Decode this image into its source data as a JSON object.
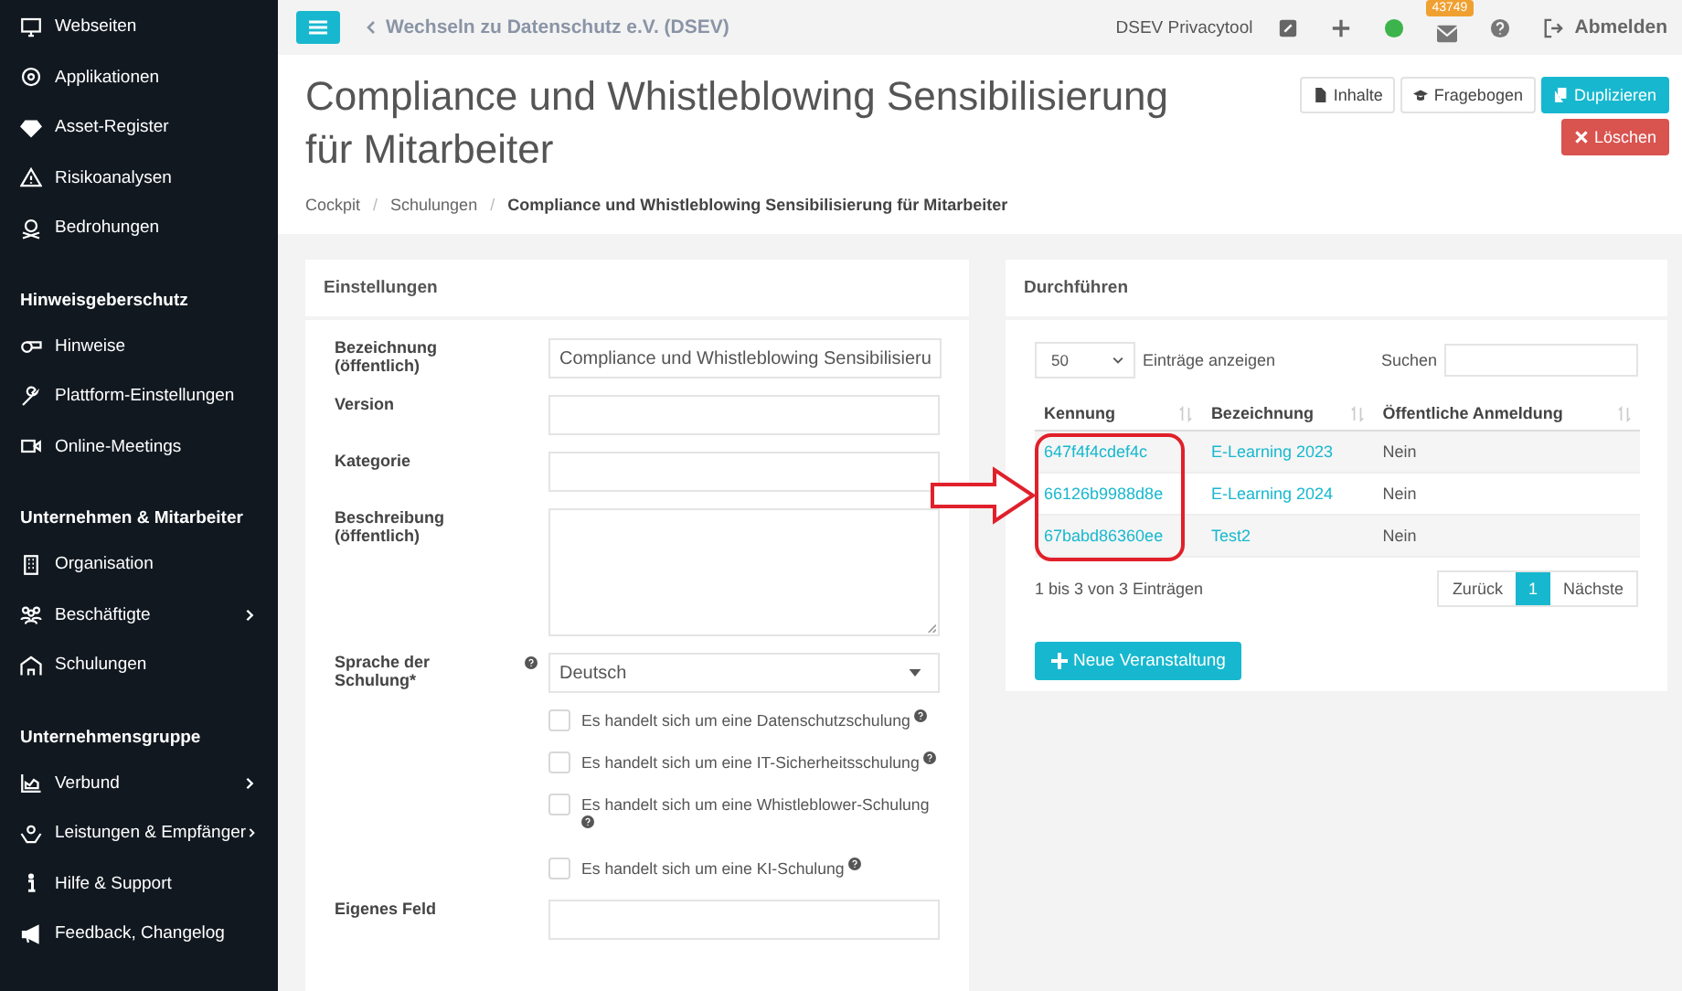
{
  "sidebar": {
    "groups": [
      {
        "items": [
          {
            "label": "Webseiten",
            "submenu": false
          },
          {
            "label": "Applikationen",
            "submenu": false
          },
          {
            "label": "Asset-Register",
            "submenu": false
          },
          {
            "label": "Risikoanalysen",
            "submenu": false
          },
          {
            "label": "Bedrohungen",
            "submenu": false
          }
        ]
      },
      {
        "heading": "Hinweisgeberschutz",
        "items": [
          {
            "label": "Hinweise",
            "submenu": false
          },
          {
            "label": "Plattform-Einstellungen",
            "submenu": false
          },
          {
            "label": "Online-Meetings",
            "submenu": false
          }
        ]
      },
      {
        "heading": "Unternehmen & Mitarbeiter",
        "items": [
          {
            "label": "Organisation",
            "submenu": false
          },
          {
            "label": "Beschäftigte",
            "submenu": true
          },
          {
            "label": "Schulungen",
            "submenu": false
          }
        ]
      },
      {
        "heading": "Unternehmensgruppe",
        "items": [
          {
            "label": "Verbund",
            "submenu": true
          },
          {
            "label": "Leistungen & Empfänger",
            "submenu": true
          },
          {
            "label": "Hilfe & Support",
            "submenu": false
          },
          {
            "label": "Feedback, Changelog",
            "submenu": false
          }
        ]
      }
    ]
  },
  "topbar": {
    "back_link": "Wechseln zu Datenschutz e.V. (DSEV)",
    "app_name": "DSEV Privacytool",
    "mail_badge": "43749",
    "logout": "Abmelden"
  },
  "header": {
    "title": "Compliance und Whistleblowing Sensibilisierung für Mitarbeiter",
    "buttons": [
      {
        "kind": "plain",
        "label": "Inhalte"
      },
      {
        "kind": "plain",
        "label": "Fragebogen"
      },
      {
        "kind": "primary",
        "label": "Duplizieren"
      },
      {
        "kind": "danger",
        "label": "Löschen"
      }
    ],
    "breadcrumb": [
      "Cockpit",
      "/",
      "Schulungen",
      "/",
      "Compliance und Whistleblowing Sensibilisierung für Mitarbeiter"
    ]
  },
  "settings": {
    "title": "Einstellungen",
    "fields": [
      {
        "kind": "text",
        "label": "Bezeichnung (öffentlich)",
        "value": "Compliance und Whistleblowing Sensibilisieru",
        "help": false
      },
      {
        "kind": "text",
        "label": "Version",
        "help": false
      },
      {
        "kind": "text",
        "label": "Kategorie",
        "help": false
      },
      {
        "kind": "textarea",
        "label": "Beschreibung (öffentlich)",
        "help": false
      },
      {
        "kind": "select",
        "label": "Sprache der Schulung*",
        "value": "Deutsch",
        "help": true
      }
    ],
    "checkboxes": [
      {
        "label": "Es handelt sich um eine Datenschutzschulung",
        "checked": false
      },
      {
        "label": "Es handelt sich um eine IT-Sicherheitsschulung",
        "checked": false
      },
      {
        "label": "Es handelt sich um eine Whistleblower-Schulung",
        "checked": false
      },
      {
        "label": "Es handelt sich um eine KI-Schulung",
        "checked": false
      }
    ],
    "last_field_label": "Eigenes Feld"
  },
  "execute": {
    "title": "Durchführen",
    "page_size": "50",
    "page_size_label": "Einträge anzeigen",
    "search_label": "Suchen",
    "columns": [
      "Kennung",
      "Bezeichnung",
      "Öffentliche Anmeldung"
    ],
    "rows": [
      {
        "id": "647f4f4cdef4c",
        "name": "E-Learning 2023",
        "public": "Nein"
      },
      {
        "id": "66126b9988d8e",
        "name": "E-Learning 2024",
        "public": "Nein"
      },
      {
        "id": "67babd86360ee",
        "name": "Test2",
        "public": "Nein"
      }
    ],
    "info": "1 bis 3 von 3 Einträgen",
    "pages": [
      {
        "label": "Zurück",
        "selected": false
      },
      {
        "label": "1",
        "selected": true
      },
      {
        "label": "Nächste",
        "selected": false
      }
    ],
    "new_button": "Neue Veranstaltung"
  }
}
